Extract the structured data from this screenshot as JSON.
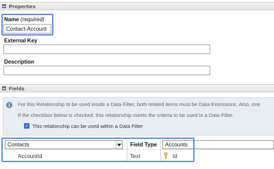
{
  "properties": {
    "section_title": "Properties",
    "name_label": "Name",
    "name_required": "(required)",
    "name_value": "Contact-Account",
    "external_key_label": "External Key",
    "external_key_value": "",
    "description_label": "Description",
    "description_value": ""
  },
  "fields": {
    "section_title": "Fields",
    "info_line1": "For this Relationship to be used inside a Data Filter, both related items must be Data Extensions. Also, one",
    "info_line2": "If the checkbox below is checked, this relationship meets the criteria to be used in a Data Filter.",
    "checkbox_label": "This relationship can be used within a Data Filter",
    "checkbox_checked": true,
    "left_select_value": "Contacts",
    "field_type_header": "Field Type",
    "right_object": "Accounts",
    "row": {
      "left_field": "AccountId",
      "field_type": "Text",
      "right_field": "Id"
    }
  },
  "colors": {
    "highlight": "#5a8fe6",
    "checkbox": "#2f6fd6",
    "info_bg": "#e8edf3",
    "key_icon": "#d9a21b"
  },
  "icons": [
    "collapse-icon",
    "info-icon",
    "checkmark-icon",
    "chevron-down-icon",
    "key-icon"
  ]
}
